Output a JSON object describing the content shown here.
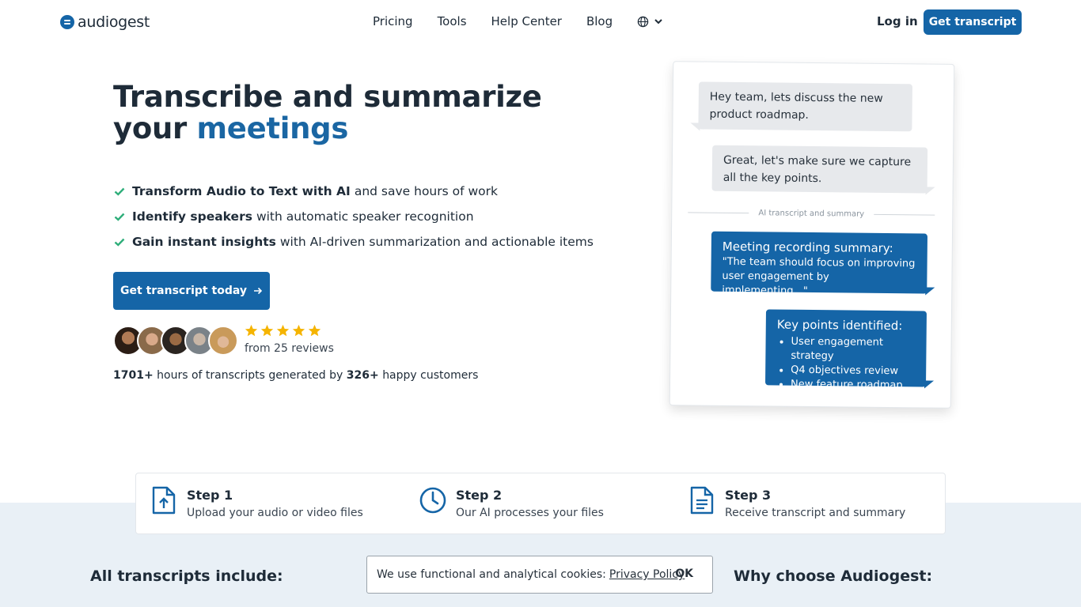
{
  "nav": {
    "logo_text": "audiogest",
    "links": [
      "Pricing",
      "Tools",
      "Help Center",
      "Blog"
    ],
    "login": "Log in",
    "cta": "Get transcript"
  },
  "hero": {
    "title_line1": "Transcribe and summarize",
    "title_your": "your",
    "title_accent": "meetings",
    "features": [
      {
        "bold": "Transform Audio to Text with AI",
        "rest": "and save hours of work"
      },
      {
        "bold": "Identify speakers",
        "rest": "with automatic speaker recognition"
      },
      {
        "bold": "Gain instant insights",
        "rest": "with AI-driven summarization and actionable items"
      }
    ],
    "cta": "Get transcript today",
    "reviews": "from 25 reviews",
    "rating": 5,
    "stats_hours": "1701+",
    "stats_mid": "hours of transcripts generated by",
    "stats_customers": "326+",
    "stats_end": "happy customers"
  },
  "chat": {
    "msg1": "Hey team, lets discuss the new product roadmap.",
    "msg2": "Great, let's make sure we capture all the key points.",
    "divider": "AI transcript and summary",
    "summary_title": "Meeting recording summary:",
    "summary_quote": "\"The team should focus on improving user engagement by implementing...\"",
    "keypoints_title": "Key points identified:",
    "keypoints": [
      "User engagement strategy",
      "Q4 objectives review",
      "New feature roadmap"
    ]
  },
  "steps": [
    {
      "title": "Step 1",
      "desc": "Upload your audio or video files"
    },
    {
      "title": "Step 2",
      "desc": "Our AI processes your files"
    },
    {
      "title": "Step 3",
      "desc": "Receive transcript and summary"
    }
  ],
  "sections": {
    "left_title": "All transcripts include:",
    "right_title": "Why choose Audiogest:"
  },
  "cookie": {
    "text": "We use functional and analytical cookies:",
    "link": "Privacy Policy",
    "ok": "OK"
  },
  "colors": {
    "brand": "#1565a7",
    "check": "#2fae7a",
    "star": "#f5b400",
    "band": "#e9f0f6"
  }
}
